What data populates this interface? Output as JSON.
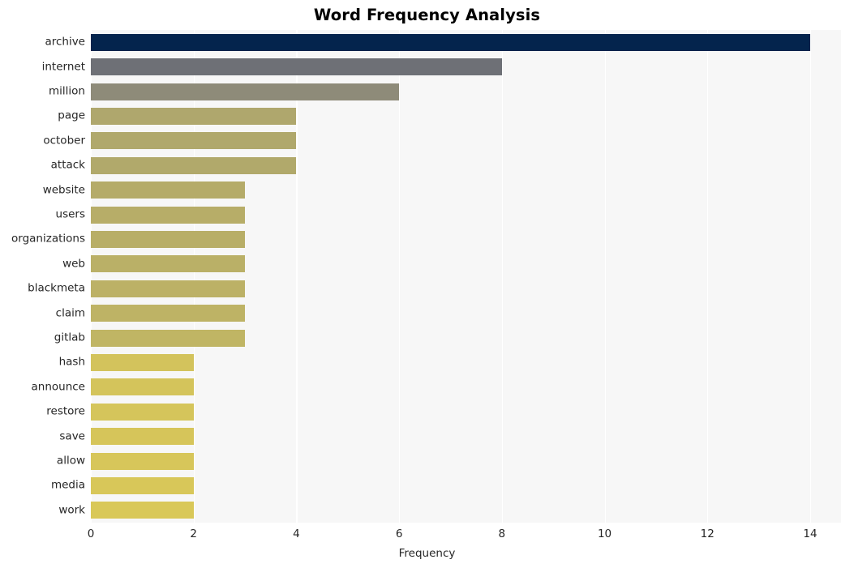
{
  "chart_data": {
    "type": "bar",
    "orientation": "horizontal",
    "title": "Word Frequency Analysis",
    "xlabel": "Frequency",
    "ylabel": "",
    "xlim": [
      0,
      14.6
    ],
    "xticks": [
      0,
      2,
      4,
      6,
      8,
      10,
      12,
      14
    ],
    "xticklabels": [
      "0",
      "2",
      "4",
      "6",
      "8",
      "10",
      "12",
      "14"
    ],
    "grid": "vertical-only",
    "legend": "none",
    "categories": [
      "archive",
      "internet",
      "million",
      "page",
      "october",
      "attack",
      "website",
      "users",
      "organizations",
      "web",
      "blackmeta",
      "claim",
      "gitlab",
      "hash",
      "announce",
      "restore",
      "save",
      "allow",
      "media",
      "work"
    ],
    "values": [
      14,
      8,
      6,
      4,
      4,
      4,
      3,
      3,
      3,
      3,
      3,
      3,
      3,
      2,
      2,
      2,
      2,
      2,
      2,
      2
    ],
    "bar_colors": [
      "#04244d",
      "#6e7076",
      "#8e8b79",
      "#afa76d",
      "#b0a86c",
      "#b1a96b",
      "#b5ab69",
      "#b7ad68",
      "#b8ae67",
      "#bab067",
      "#bcb166",
      "#beb365",
      "#c0b564",
      "#d3c35c",
      "#d4c45b",
      "#d5c55b",
      "#d6c55a",
      "#d7c65a",
      "#d8c759",
      "#d9c858"
    ],
    "colormap": "cividis",
    "plot_background": "#f7f7f7",
    "gridline_color": "#ffffff",
    "title_color": "#000000",
    "tick_color": "#262626"
  }
}
